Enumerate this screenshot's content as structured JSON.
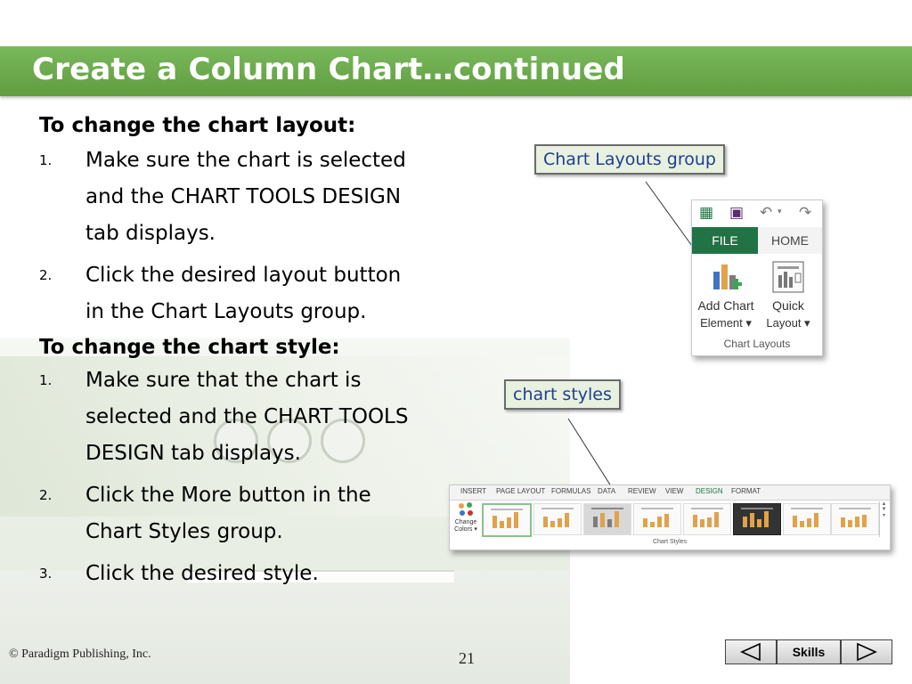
{
  "slide": {
    "title": "Create a Column Chart…continued"
  },
  "content": {
    "section1": {
      "heading": "To change the chart layout:",
      "steps": [
        {
          "num": "1.",
          "lines": [
            "Make sure the chart is selected",
            "and the CHART TOOLS DESIGN",
            "tab displays."
          ]
        },
        {
          "num": "2.",
          "lines": [
            "Click the desired layout button",
            "in the Chart Layouts group."
          ]
        }
      ]
    },
    "section2": {
      "heading": "To change the chart style:",
      "steps": [
        {
          "num": "1.",
          "lines": [
            "Make sure that the chart is",
            "selected and the CHART TOOLS",
            "DESIGN tab displays."
          ]
        },
        {
          "num": "2.",
          "lines": [
            "Click the More button in the",
            "Chart Styles group."
          ]
        },
        {
          "num": "3.",
          "lines": [
            "Click the desired style."
          ]
        }
      ]
    }
  },
  "callouts": {
    "layouts": "Chart Layouts group",
    "styles": "chart styles"
  },
  "ribbon_layouts": {
    "file_tab": "FILE",
    "home_tab": "HOME",
    "add_chart": {
      "line1": "Add Chart",
      "line2": "Element ▾"
    },
    "quick_layout": {
      "line1": "Quick",
      "line2": "Layout ▾"
    },
    "group_label": "Chart Layouts"
  },
  "ribbon_styles": {
    "tabs": [
      "INSERT",
      "PAGE LAYOUT",
      "FORMULAS",
      "DATA",
      "REVIEW",
      "VIEW",
      "DESIGN",
      "FORMAT"
    ],
    "active_tab": "DESIGN",
    "change_colors": {
      "line1": "Change",
      "line2": "Colors ▾"
    },
    "group_label": "Chart Styles"
  },
  "footer": {
    "copyright": "© Paradigm Publishing, Inc.",
    "page_number": "21",
    "skills_label": "Skills"
  },
  "colors": {
    "title_bar": "#6aa84f",
    "excel_green": "#217346",
    "callout_text": "#1f3f8f"
  }
}
